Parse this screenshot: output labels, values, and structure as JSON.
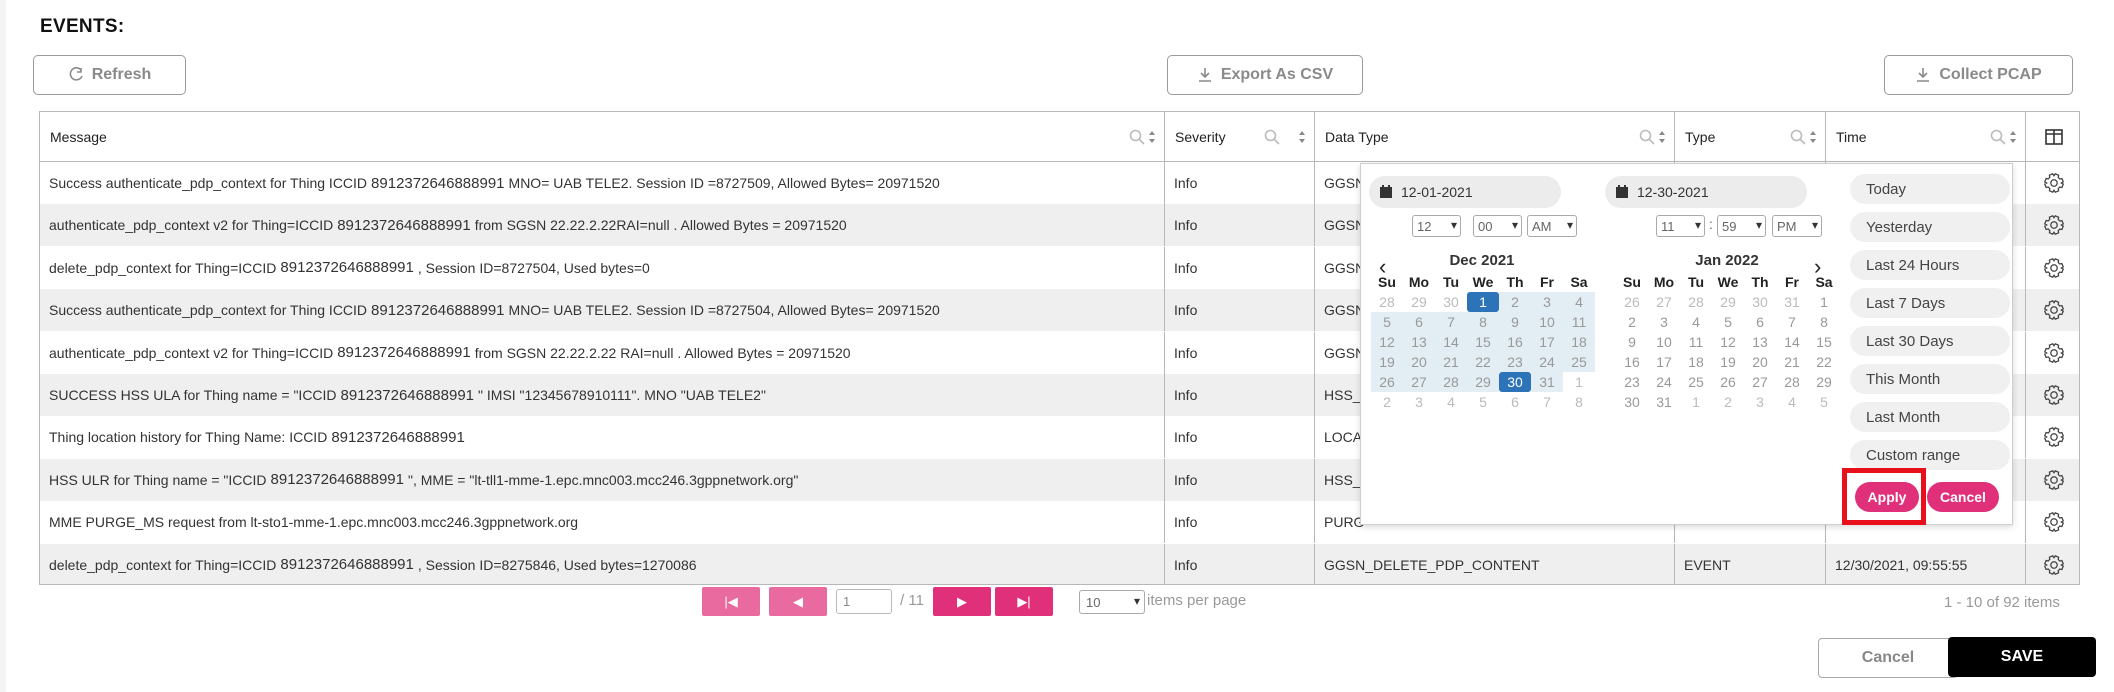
{
  "header": {
    "title": "EVENTS:"
  },
  "toolbar": {
    "refresh": "Refresh",
    "export": "Export As CSV",
    "pcap": "Collect PCAP"
  },
  "columns": {
    "message": "Message",
    "severity": "Severity",
    "data_type": "Data Type",
    "type": "Type",
    "time": "Time"
  },
  "rows": [
    {
      "pre": "Success authenticate_pdp_context for Thing ICCID",
      "iccid": "8912372646888991",
      "post": "MNO= UAB TELE2. Session ID =8727509, Allowed Bytes= 20971520",
      "severity": "Info",
      "data_type": "GGSN",
      "type": "",
      "time": ""
    },
    {
      "pre": "authenticate_pdp_context v2 for Thing=ICCID",
      "iccid": "8912372646888991",
      "post": "from SGSN 22.22.2.22RAI=null . Allowed Bytes = 20971520",
      "severity": "Info",
      "data_type": "GGSN",
      "type": "",
      "time": ""
    },
    {
      "pre": "delete_pdp_context for Thing=ICCID",
      "iccid": "8912372646888991",
      "post": ", Session ID=8727504, Used bytes=0",
      "severity": "Info",
      "data_type": "GGSN",
      "type": "",
      "time": ""
    },
    {
      "pre": "Success authenticate_pdp_context for Thing ICCID",
      "iccid": "8912372646888991",
      "post": "MNO= UAB TELE2. Session ID =8727504, Allowed Bytes= 20971520",
      "severity": "Info",
      "data_type": "GGSN",
      "type": "",
      "time": ""
    },
    {
      "pre": "authenticate_pdp_context v2 for Thing=ICCID",
      "iccid": "8912372646888991",
      "post": "from SGSN 22.22.2.22 RAI=null . Allowed Bytes = 20971520",
      "severity": "Info",
      "data_type": "GGSN",
      "type": "",
      "time": ""
    },
    {
      "pre": "SUCCESS HSS ULA for Thing name = \"ICCID",
      "iccid": "8912372646888991",
      "post": "\" IMSI \"12345678910111\". MNO \"UAB TELE2\"",
      "severity": "Info",
      "data_type": "HSS_",
      "type": "",
      "time": ""
    },
    {
      "pre": "Thing location history for Thing Name: ICCID",
      "iccid": "8912372646888991",
      "post": "",
      "severity": "Info",
      "data_type": "LOCA",
      "type": "",
      "time": ""
    },
    {
      "pre": "HSS ULR for Thing name = \"ICCID",
      "iccid": "8912372646888991",
      "post": "\", MME = \"lt-tll1-mme-1.epc.mnc003.mcc246.3gppnetwork.org\"",
      "severity": "Info",
      "data_type": "HSS_",
      "type": "",
      "time": ""
    },
    {
      "pre": "MME PURGE_MS request from lt-sto1-mme-1.epc.mnc003.mcc246.3gppnetwork.org",
      "iccid": "",
      "post": "",
      "severity": "Info",
      "data_type": "PURG",
      "type": "",
      "time": ""
    },
    {
      "pre": "delete_pdp_context for Thing=ICCID",
      "iccid": "8912372646888991",
      "post": ", Session ID=8275846, Used bytes=1270086",
      "severity": "Info",
      "data_type": "GGSN_DELETE_PDP_CONTENT",
      "type": "EVENT",
      "time": "12/30/2021, 09:55:55"
    }
  ],
  "datepicker": {
    "start_date": "12-01-2021",
    "end_date": "12-30-2021",
    "start_time": {
      "hour": "12",
      "minute": "00",
      "ampm": "AM"
    },
    "end_time": {
      "hour": "11",
      "sep": ":",
      "minute": "59",
      "ampm": "PM"
    },
    "weekdays": [
      "Su",
      "Mo",
      "Tu",
      "We",
      "Th",
      "Fr",
      "Sa"
    ],
    "left_month": "Dec 2021",
    "right_month": "Jan 2022",
    "left_days": [
      "28",
      "29",
      "30",
      "1",
      "2",
      "3",
      "4",
      "5",
      "6",
      "7",
      "8",
      "9",
      "10",
      "11",
      "12",
      "13",
      "14",
      "15",
      "16",
      "17",
      "18",
      "19",
      "20",
      "21",
      "22",
      "23",
      "24",
      "25",
      "26",
      "27",
      "28",
      "29",
      "30",
      "31",
      "1",
      "2",
      "3",
      "4",
      "5",
      "6",
      "7",
      "8"
    ],
    "right_days": [
      "26",
      "27",
      "28",
      "29",
      "30",
      "31",
      "1",
      "2",
      "3",
      "4",
      "5",
      "6",
      "7",
      "8",
      "9",
      "10",
      "11",
      "12",
      "13",
      "14",
      "15",
      "16",
      "17",
      "18",
      "19",
      "20",
      "21",
      "22",
      "23",
      "24",
      "25",
      "26",
      "27",
      "28",
      "29",
      "30",
      "31",
      "1",
      "2",
      "3",
      "4",
      "5"
    ],
    "ranges": [
      "Today",
      "Yesterday",
      "Last 24 Hours",
      "Last 7 Days",
      "Last 30 Days",
      "This Month",
      "Last Month",
      "Custom range"
    ],
    "apply": "Apply",
    "cancel": "Cancel"
  },
  "pagination": {
    "page": "1",
    "of_pages": "/ 11",
    "per_page": "10",
    "per_page_label": "items per page",
    "summary": "1 - 10 of 92 items"
  },
  "footer": {
    "cancel": "Cancel",
    "save": "SAVE"
  },
  "colors": {
    "accent": "#e0307a",
    "selected_day": "#2c73b8",
    "highlight": "#e8101a"
  }
}
